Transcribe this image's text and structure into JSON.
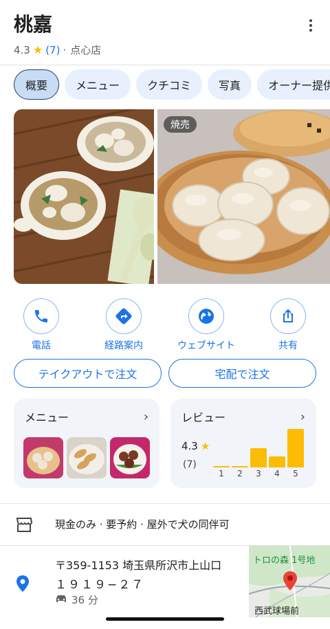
{
  "place": {
    "name": "桃嘉",
    "rating": "4.3",
    "review_count": "(7)",
    "separator": "·",
    "category": "点心店"
  },
  "tabs": [
    {
      "label": "概要",
      "active": true
    },
    {
      "label": "メニュー"
    },
    {
      "label": "クチコミ"
    },
    {
      "label": "写真"
    },
    {
      "label": "オーナー提供"
    }
  ],
  "photos": {
    "badge": "焼売"
  },
  "actions": [
    {
      "label": "電話",
      "icon": "phone-icon"
    },
    {
      "label": "経路案内",
      "icon": "directions-icon"
    },
    {
      "label": "ウェブサイト",
      "icon": "globe-icon"
    },
    {
      "label": "共有",
      "icon": "share-icon"
    }
  ],
  "order_buttons": {
    "takeout": "テイクアウトで注文",
    "delivery": "宅配で注文"
  },
  "menu_card": {
    "title": "メニュー"
  },
  "review_card": {
    "title": "レビュー",
    "rating": "4.3",
    "count": "(7)",
    "distribution": [
      {
        "stars": "1",
        "share": 0.03
      },
      {
        "stars": "2",
        "share": 0.03
      },
      {
        "stars": "3",
        "share": 0.5
      },
      {
        "stars": "4",
        "share": 0.28
      },
      {
        "stars": "5",
        "share": 1.0
      }
    ]
  },
  "amenities": {
    "text": "現金のみ · 要予約 · 屋外で犬の同伴可"
  },
  "address": {
    "line1": "〒359-1153 埼玉県所沢市上山口",
    "line2": "１９１９−２７",
    "drive_time": "36 分"
  },
  "map": {
    "label_top": "トロの森 1号地",
    "label_bottom": "西武球場前"
  },
  "colors": {
    "accent": "#1a73e8",
    "star": "#fbbc04",
    "chip_bg": "#e8f0fe",
    "card_bg": "#f1f4f8",
    "pin": "#ea4335"
  }
}
